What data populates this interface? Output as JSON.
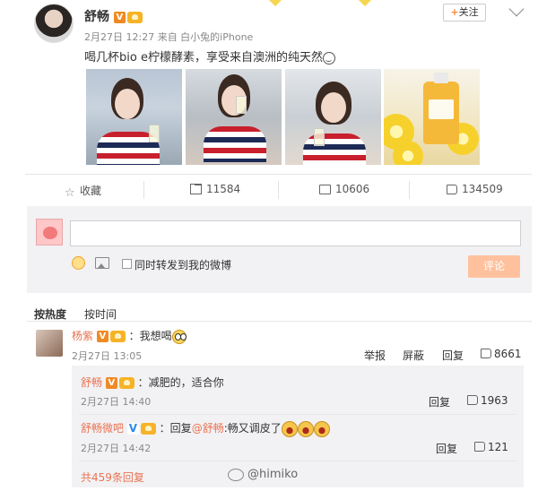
{
  "post": {
    "author": "舒畅",
    "meta": "2月27日 12:27 来自 白小兔的iPhone",
    "follow_label": "关注",
    "text": "喝几杯bio e柠檬酵素，享受来自澳洲的纯天然",
    "photos": [
      "photo-1",
      "photo-2",
      "photo-3",
      "photo-4"
    ]
  },
  "actions": {
    "favorite": "收藏",
    "repost": "11584",
    "comment": "10606",
    "like": "134509"
  },
  "composer": {
    "input_value": "",
    "repost_checkbox_label": "同时转发到我的微博",
    "submit_label": "评论"
  },
  "sort_tabs": [
    "按热度",
    "按时间"
  ],
  "comments": [
    {
      "name": "杨紫",
      "text": "：我想喝",
      "time": "2月27日 13:05",
      "report": "举报",
      "block": "屏蔽",
      "reply": "回复",
      "likes": "8661"
    }
  ],
  "replies": [
    {
      "name": "舒畅",
      "text": "：减肥的，适合你",
      "time": "2月27日 14:40",
      "reply": "回复",
      "likes": "1963"
    },
    {
      "name": "舒畅微吧",
      "text_prefix": "：回复",
      "mention": "@舒畅",
      "text_suffix": ":畅又调皮了",
      "time": "2月27日 14:42",
      "reply": "回复",
      "likes": "121"
    }
  ],
  "more_replies": "共459条回复",
  "watermark": "@himiko",
  "colors": {
    "accent_orange": "#eb7350",
    "submit_button": "#ffc19d",
    "reply_background": "#f2f2f5"
  }
}
